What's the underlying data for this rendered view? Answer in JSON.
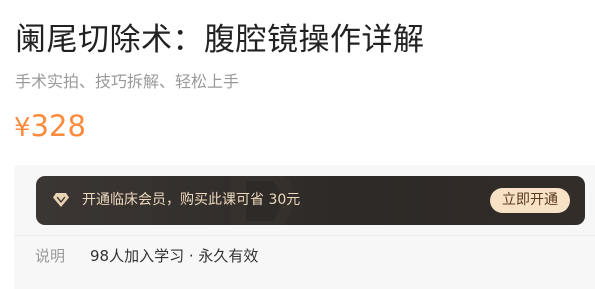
{
  "course": {
    "title": "阑尾切除术：腹腔镜操作详解",
    "subtitle": "手术实拍、技巧拆解、轻松上手"
  },
  "price": {
    "currency_symbol": "¥",
    "amount": "328",
    "color": "#ff8a3d"
  },
  "vip_banner": {
    "icon": "diamond-icon",
    "text": "开通临床会员，购买此课可省 30元",
    "button_label": "立即开通",
    "accent_color": "#ecd9bd",
    "background_color": "#2d2926"
  },
  "description": {
    "label": "说明",
    "value": "98人加入学习 · 永久有效"
  }
}
